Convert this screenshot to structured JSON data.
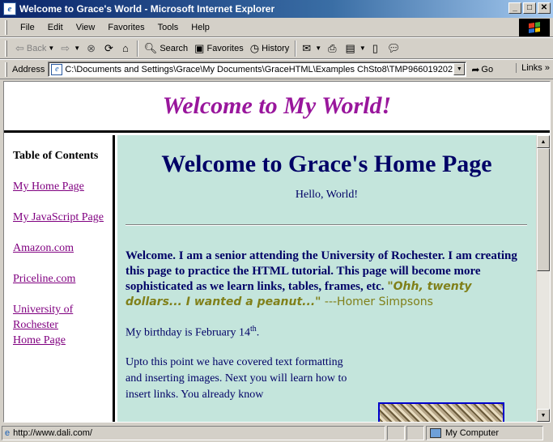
{
  "window": {
    "title": "Welcome to Grace's World - Microsoft Internet Explorer",
    "buttons": {
      "minimize": "_",
      "maximize": "□",
      "close": "✕"
    }
  },
  "menu": {
    "items": [
      "File",
      "Edit",
      "View",
      "Favorites",
      "Tools",
      "Help"
    ]
  },
  "toolbar": {
    "back": "Back",
    "search": "Search",
    "favorites": "Favorites",
    "history": "History"
  },
  "address": {
    "label": "Address",
    "url": "C:\\Documents and Settings\\Grace\\My Documents\\GraceHTML\\Examples ChSto8\\TMP966019202.htm",
    "go": "Go",
    "links": "Links"
  },
  "page": {
    "banner": "Welcome to My World!",
    "toc": {
      "title": "Table of Contents",
      "links": [
        "My Home Page",
        "My JavaScript Page",
        "Amazon.com",
        "Priceline.com",
        "University of Rochester Home Page"
      ]
    },
    "main": {
      "title": "Welcome to Grace's Home Page",
      "hello": "Hello, World!",
      "welcome": "Welcome. I am a senior attending the University of Rochester. I am creating this page to practice the HTML tutorial. This page will become more sophisticated as we learn links, tables, frames, etc.",
      "quote": "\"Ohh, twenty dollars... I wanted a peanut...\"",
      "quote_attribution": " ---Homer Simpsons",
      "birthday": "My birthday is February 14",
      "birthday_sup": "th",
      "birthday_end": ".",
      "upto": "Upto this point we have covered text formatting and inserting images. Next you will learn how to insert links. You already know"
    }
  },
  "status": {
    "text": "http://www.dali.com/",
    "zone": "My Computer"
  },
  "colors": {
    "banner": "#99169c",
    "main_bg": "#c4e5dc",
    "main_text": "#000066",
    "link_visited": "#800080",
    "quote": "#80801a"
  }
}
